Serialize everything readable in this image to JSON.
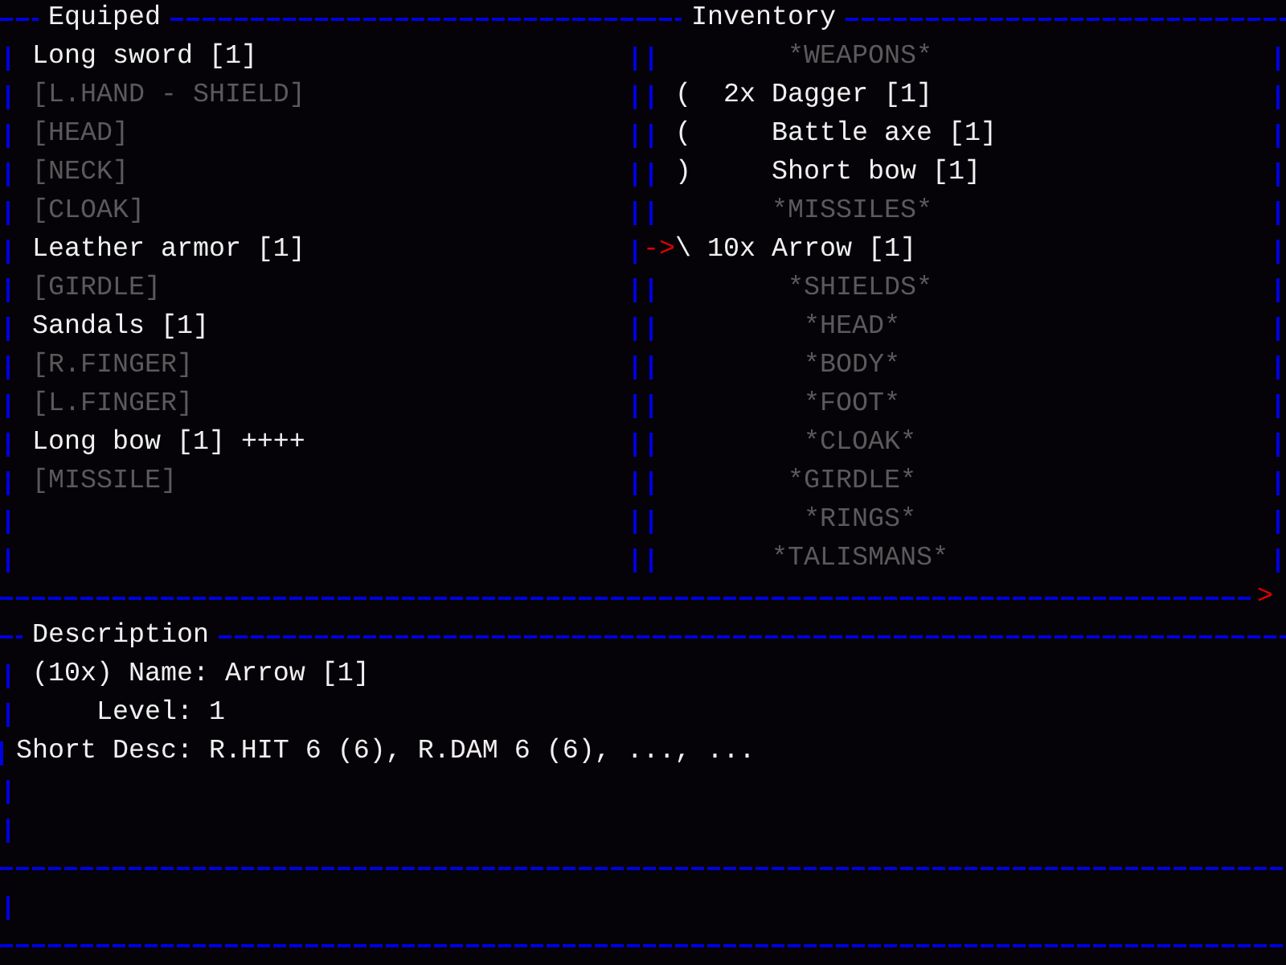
{
  "equipped": {
    "title": "Equiped",
    "slots": [
      {
        "text": "Long sword [1]",
        "empty": false
      },
      {
        "text": "[L.HAND - SHIELD]",
        "empty": true
      },
      {
        "text": "[HEAD]",
        "empty": true
      },
      {
        "text": "[NECK]",
        "empty": true
      },
      {
        "text": "[CLOAK]",
        "empty": true
      },
      {
        "text": "Leather armor [1]",
        "empty": false
      },
      {
        "text": "[GIRDLE]",
        "empty": true
      },
      {
        "text": "Sandals [1]",
        "empty": false
      },
      {
        "text": "[R.FINGER]",
        "empty": true
      },
      {
        "text": "[L.FINGER]",
        "empty": true
      },
      {
        "text": "Long bow [1] ++++",
        "empty": false
      },
      {
        "text": "[MISSILE]",
        "empty": true
      }
    ]
  },
  "inventory": {
    "title": "Inventory",
    "cursor": "->",
    "rows": [
      {
        "kind": "category",
        "label": "*WEAPONS*"
      },
      {
        "kind": "item",
        "symbol": "(",
        "count": "2x",
        "name": "Dagger [1]",
        "selected": false
      },
      {
        "kind": "item",
        "symbol": "(",
        "name": "Battle axe [1]",
        "selected": false
      },
      {
        "kind": "item",
        "symbol": ")",
        "name": "Short bow [1]",
        "selected": false
      },
      {
        "kind": "category",
        "label": "*MISSILES*"
      },
      {
        "kind": "item",
        "symbol": "\\",
        "count": "10x",
        "name": "Arrow [1]",
        "selected": true
      },
      {
        "kind": "category",
        "label": "*SHIELDS*"
      },
      {
        "kind": "category",
        "label": "*HEAD*"
      },
      {
        "kind": "category",
        "label": "*BODY*"
      },
      {
        "kind": "category",
        "label": "*FOOT*"
      },
      {
        "kind": "category",
        "label": "*CLOAK*"
      },
      {
        "kind": "category",
        "label": "*GIRDLE*"
      },
      {
        "kind": "category",
        "label": "*RINGS*"
      },
      {
        "kind": "category",
        "label": "*TALISMANS*"
      }
    ],
    "scroll_marker": ">"
  },
  "description": {
    "title": "Description",
    "lines": [
      {
        "kind": "name",
        "text": "(10x) Name: Arrow [1]"
      },
      {
        "kind": "level",
        "text": "Level: 1"
      },
      {
        "kind": "short",
        "text": "Short Desc: R.HIT 6 (6), R.DAM 6 (6), ..., ..."
      }
    ]
  }
}
